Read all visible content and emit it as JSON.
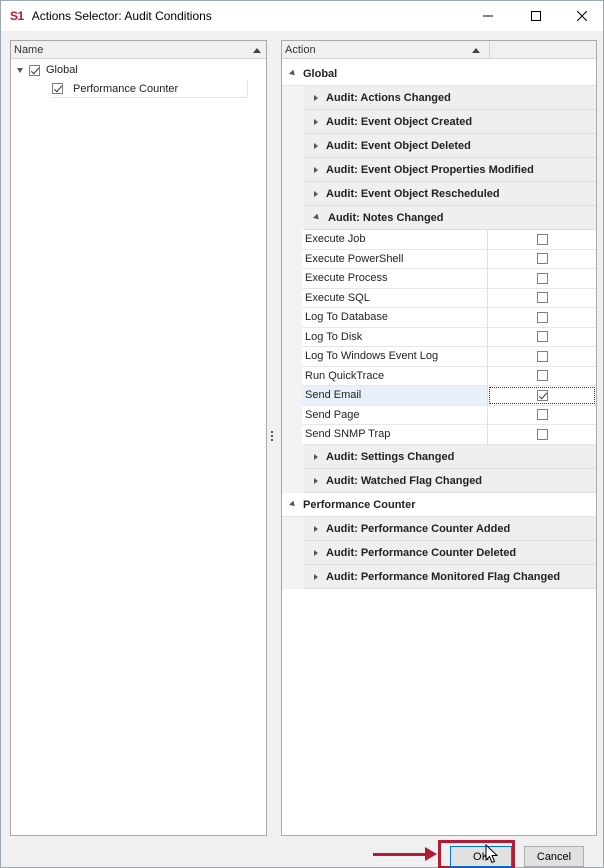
{
  "window": {
    "logo": "S1",
    "title": "Actions Selector: Audit Conditions"
  },
  "left_pane": {
    "column_header": "Name",
    "tree": [
      {
        "label": "Global",
        "checked": true,
        "level": 0
      },
      {
        "label": "Performance Counter",
        "checked": true,
        "level": 1
      }
    ]
  },
  "right_pane": {
    "column_header": "Action",
    "groups": [
      {
        "label": "Global",
        "subgroups": [
          {
            "label": "Audit: Actions Changed"
          },
          {
            "label": "Audit: Event Object Created"
          },
          {
            "label": "Audit: Event Object Deleted"
          },
          {
            "label": "Audit: Event Object Properties Modified"
          },
          {
            "label": "Audit: Event Object Rescheduled"
          },
          {
            "label": "Audit: Notes Changed",
            "expanded": true,
            "actions": [
              {
                "name": "Execute Job",
                "checked": false
              },
              {
                "name": "Execute PowerShell",
                "checked": false
              },
              {
                "name": "Execute Process",
                "checked": false
              },
              {
                "name": "Execute SQL",
                "checked": false
              },
              {
                "name": "Log To Database",
                "checked": false
              },
              {
                "name": "Log To Disk",
                "checked": false
              },
              {
                "name": "Log To Windows Event Log",
                "checked": false
              },
              {
                "name": "Run QuickTrace",
                "checked": false
              },
              {
                "name": "Send Email",
                "checked": true,
                "selected": true
              },
              {
                "name": "Send Page",
                "checked": false
              },
              {
                "name": "Send SNMP Trap",
                "checked": false
              }
            ]
          },
          {
            "label": "Audit: Settings Changed"
          },
          {
            "label": "Audit: Watched Flag Changed"
          }
        ]
      },
      {
        "label": "Performance Counter",
        "subgroups": [
          {
            "label": "Audit: Performance Counter Added"
          },
          {
            "label": "Audit: Performance Counter Deleted"
          },
          {
            "label": "Audit: Performance Monitored Flag Changed"
          }
        ]
      }
    ]
  },
  "footer": {
    "ok_label": "OK",
    "cancel_label": "Cancel"
  },
  "colors": {
    "logo": "#c8102e",
    "annotation": "#b31b34",
    "selected_row": "#e8f1fb"
  }
}
